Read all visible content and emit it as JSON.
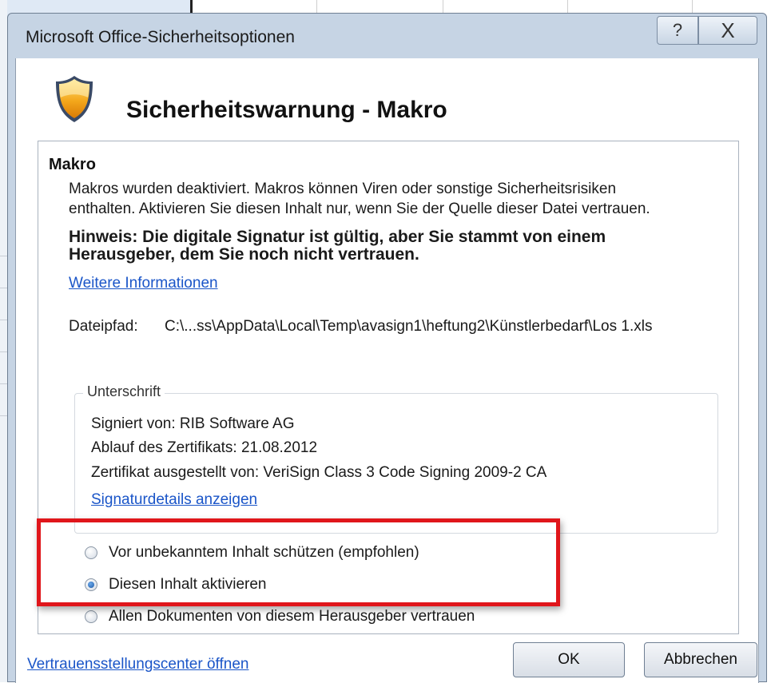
{
  "window": {
    "title": "Microsoft Office-Sicherheitsoptionen",
    "help_glyph": "?",
    "close_glyph": "X"
  },
  "header": {
    "icon": "shield-icon",
    "heading": "Sicherheitswarnung - Makro"
  },
  "section": {
    "title": "Makro",
    "description_line1": "Makros wurden deaktiviert. Makros können Viren oder sonstige Sicherheitsrisiken",
    "description_line2": "enthalten. Aktivieren Sie diesen Inhalt nur, wenn Sie der Quelle dieser Datei vertrauen.",
    "note_line1": "Hinweis: Die digitale Signatur ist gültig, aber Sie stammt von einem",
    "note_line2": "Herausgeber, dem Sie noch nicht vertrauen.",
    "more_info_link": "Weitere Informationen",
    "file_path_label": "Dateipfad:",
    "file_path_value": "C:\\...ss\\AppData\\Local\\Temp\\avasign1\\heftung2\\Künstlerbedarf\\Los 1.xls"
  },
  "signature": {
    "legend": "Unterschrift",
    "signed_by": "Signiert von: RIB Software AG",
    "expiry": "Ablauf des Zertifikats: 21.08.2012",
    "issuer": "Zertifikat ausgestellt von: VeriSign Class 3 Code Signing 2009-2 CA",
    "details_link": "Signaturdetails anzeigen"
  },
  "options": {
    "selected": "Diesen Inhalt aktivieren",
    "items": [
      {
        "label": "Vor unbekanntem Inhalt schützen (empfohlen)"
      },
      {
        "label": "Diesen Inhalt aktivieren"
      },
      {
        "label": "Allen Dokumenten von diesem Herausgeber vertrauen"
      }
    ]
  },
  "annotation": {
    "highlight_color": "#e0161b"
  },
  "footer": {
    "trust_center_link": "Vertrauensstellungscenter öffnen",
    "ok_label": "OK",
    "cancel_label": "Abbrechen"
  },
  "colors": {
    "frame": "#c6d4e4",
    "link": "#1a55c8"
  }
}
